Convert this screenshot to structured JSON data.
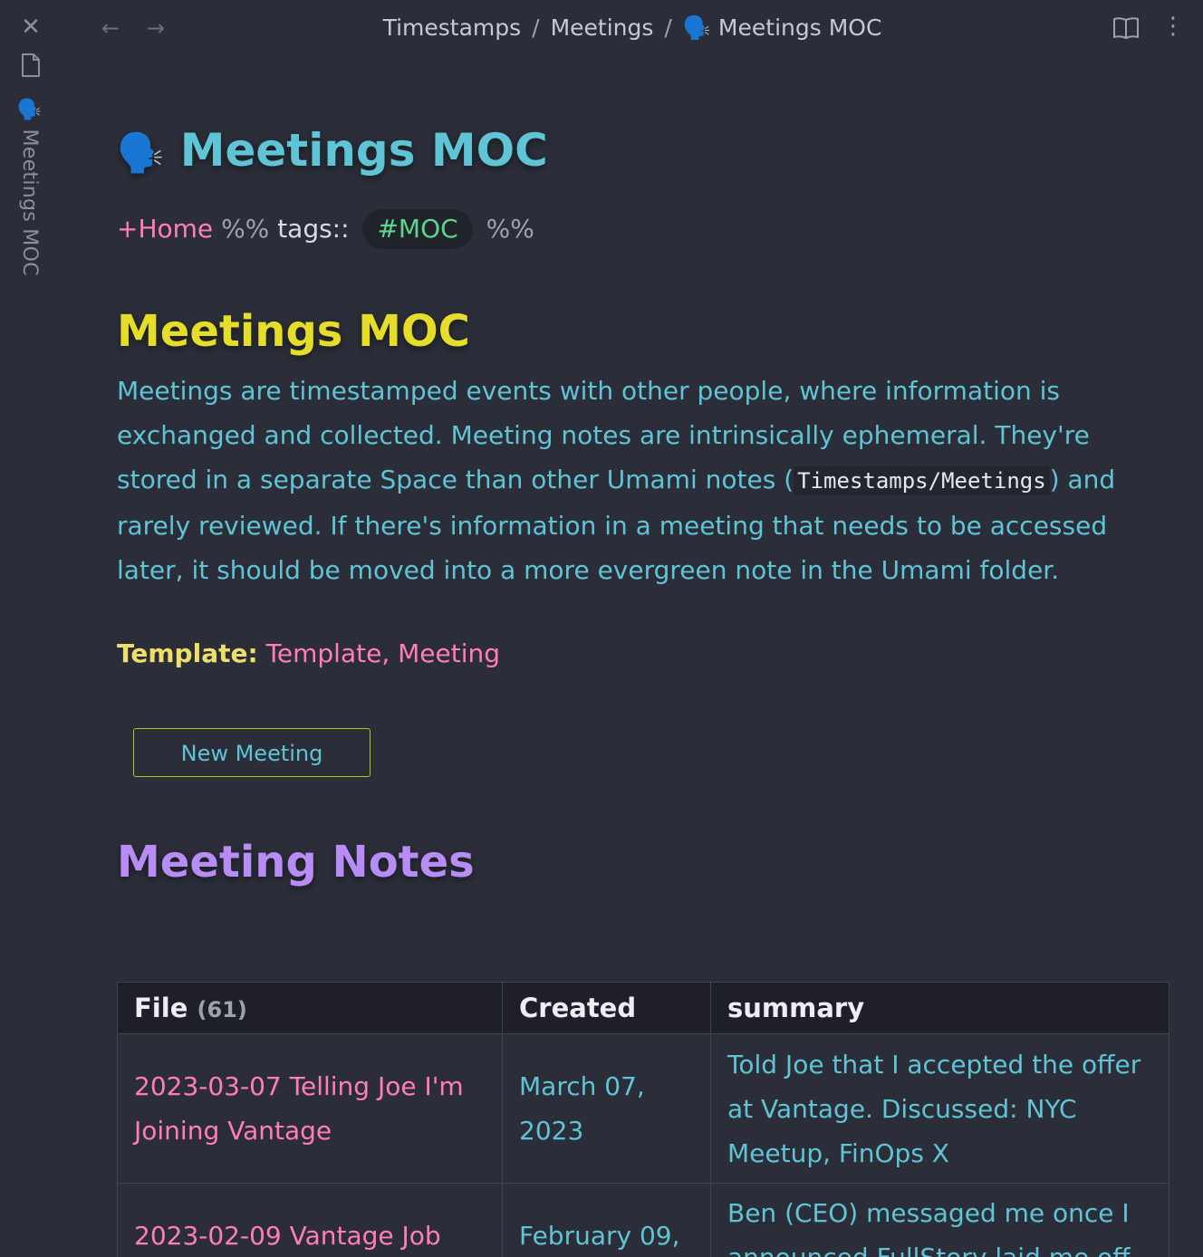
{
  "window": {
    "side_tab_title": "🗣️ Meetings MOC"
  },
  "breadcrumb": {
    "part1": "Timestamps",
    "part2": "Meetings",
    "current": "🗣️ Meetings MOC",
    "separator": "/"
  },
  "icons": {
    "close": "close-icon",
    "file": "file-icon",
    "back": "arrow-left-icon",
    "forward": "arrow-right-icon",
    "reading_mode": "book-open-icon",
    "more": "more-vertical-icon"
  },
  "page": {
    "title_emoji": "🗣️",
    "title": "Meetings MOC",
    "meta": {
      "home_link": "+Home",
      "pct_open": "%%",
      "tags_key": "tags::",
      "tag": "#MOC",
      "pct_close": "%%"
    },
    "section_heading": "Meetings MOC",
    "intro_part1": "Meetings are timestamped events with other people, where information is exchanged and collected. Meeting notes are intrinsically ephemeral. They're stored in a separate Space than other Umami notes (",
    "intro_code": "Timestamps/Meetings",
    "intro_part2": ") and rarely reviewed. If there's information in a meeting that needs to be accessed later, it should be moved into a more evergreen note in the Umami folder.",
    "template_label": "Template:",
    "template_link1": "Template",
    "template_sep": ", ",
    "template_link2": "Meeting",
    "new_meeting_button": "New Meeting",
    "notes_heading": "Meeting Notes"
  },
  "table": {
    "headers": {
      "file": "File",
      "file_count": "(61)",
      "created": "Created",
      "summary": "summary"
    },
    "rows": [
      {
        "file": "2023-03-07 Telling Joe I'm Joining Vantage",
        "created": "March 07, 2023",
        "summary": "Told Joe that I accepted the offer at Vantage. Discussed: NYC Meetup, FinOps X"
      },
      {
        "file": "2023-02-09 Vantage Job",
        "created": "February 09,",
        "summary": "Ben (CEO) messaged me once I announced FullStory laid me off"
      }
    ]
  },
  "colors": {
    "background": "#2b2e38",
    "cyan": "#5ec4d6",
    "pink": "#ff7eb6",
    "yellow": "#e6dd2a",
    "purple": "#b88cf5",
    "green": "#5dd68c"
  }
}
